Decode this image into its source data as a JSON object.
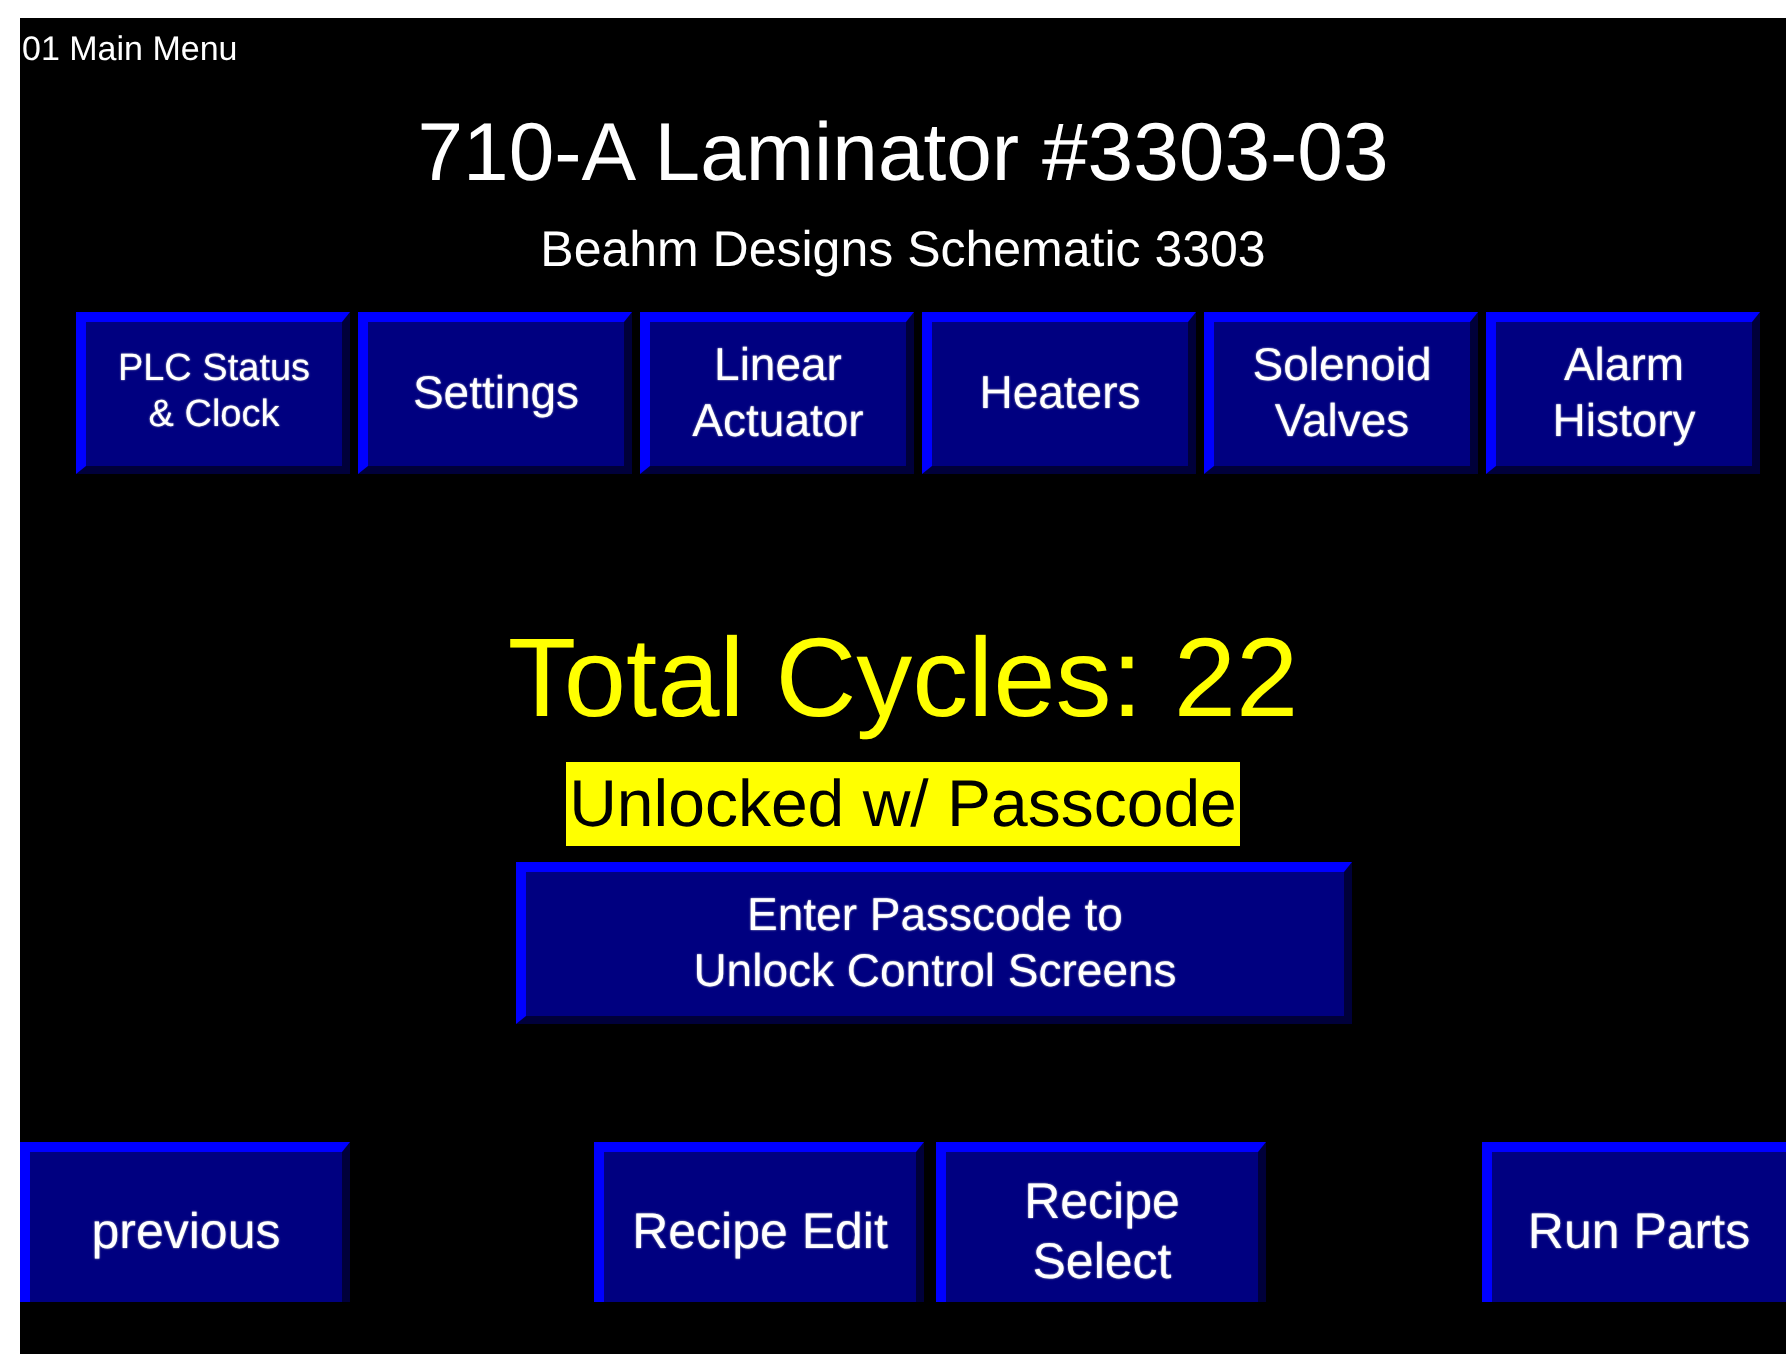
{
  "screen_label": "01 Main Menu",
  "title": "710-A Laminator #3303-03",
  "subtitle": "Beahm Designs Schematic 3303",
  "nav_buttons": [
    {
      "label": "PLC Status\n& Clock",
      "small": true
    },
    {
      "label": "Settings",
      "small": false
    },
    {
      "label": "Linear\nActuator",
      "small": false
    },
    {
      "label": "Heaters",
      "small": false
    },
    {
      "label": "Solenoid\nValves",
      "small": false
    },
    {
      "label": "Alarm\nHistory",
      "small": false
    }
  ],
  "total_cycles": "Total Cycles: 22",
  "lock_status": "Unlocked w/ Passcode",
  "passcode_button": "Enter Passcode to\nUnlock Control Screens",
  "bottom_buttons": [
    "previous",
    "Recipe Edit",
    "Recipe\nSelect",
    "Run Parts"
  ]
}
